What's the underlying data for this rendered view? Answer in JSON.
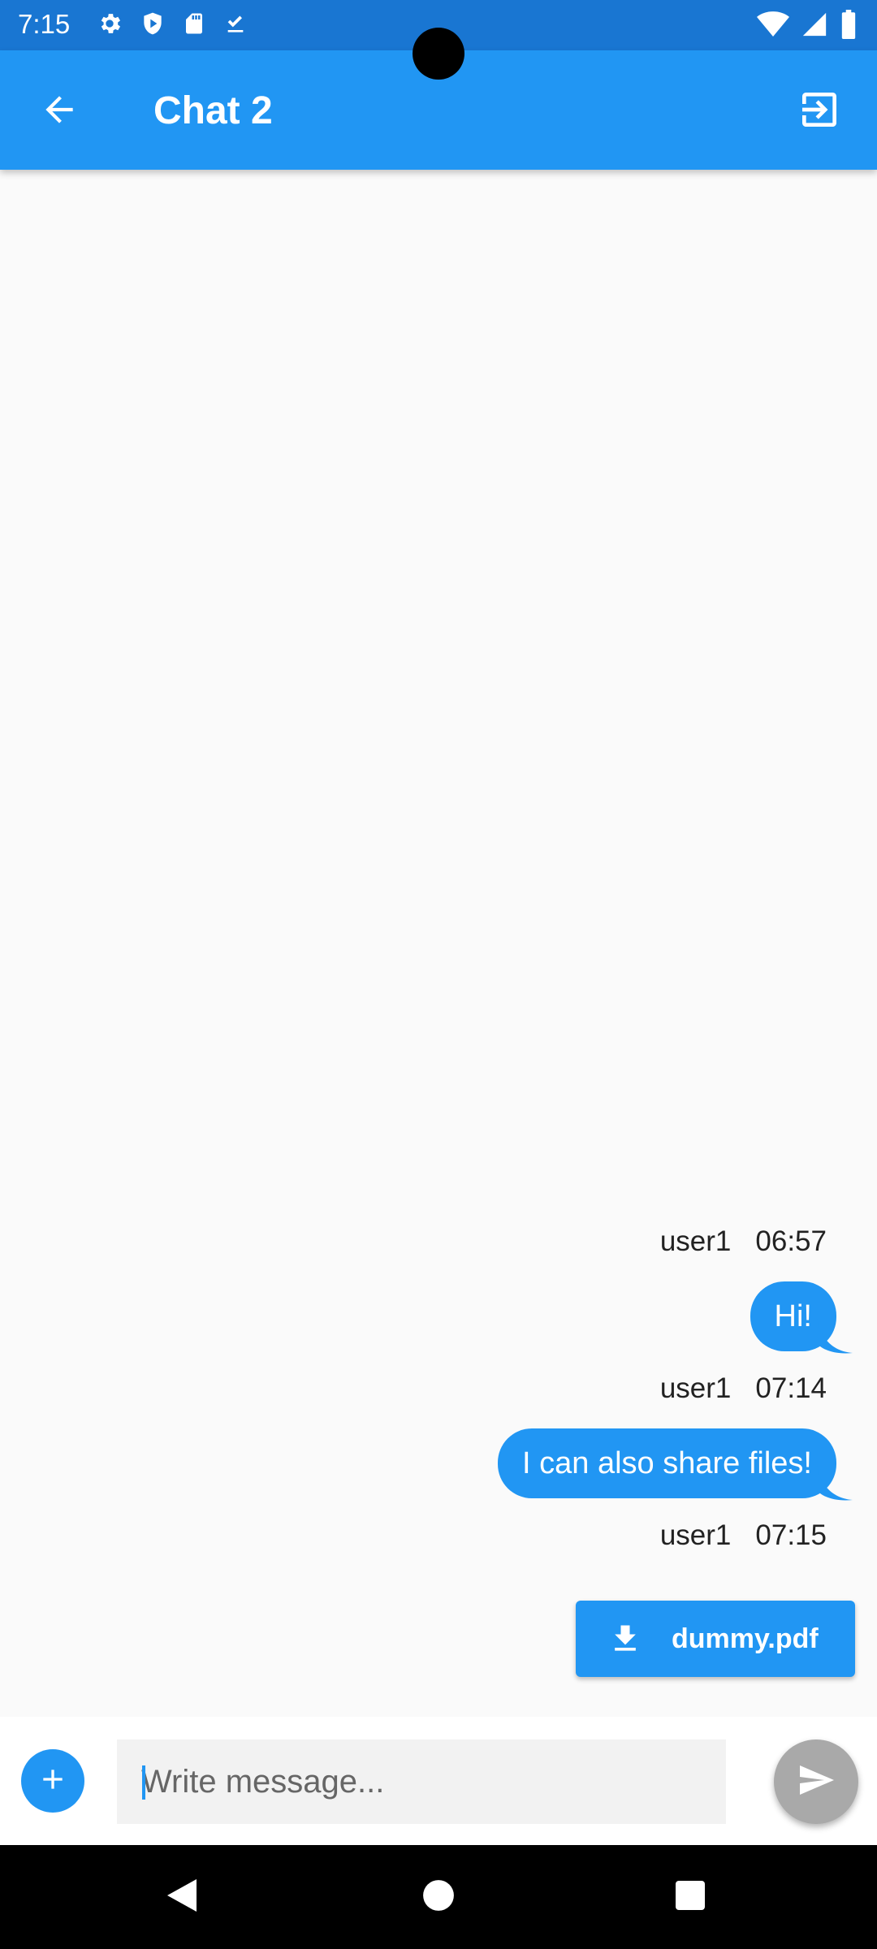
{
  "status_bar": {
    "time": "7:15",
    "left_icons": [
      "gear-icon",
      "shield-play-icon",
      "sd-card-icon",
      "download-done-icon"
    ],
    "right_icons": [
      "wifi-icon",
      "signal-icon",
      "battery-icon"
    ]
  },
  "app_bar": {
    "title": "Chat 2",
    "back_icon": "arrow-back-icon",
    "exit_icon": "exit-to-app-icon"
  },
  "messages": [
    {
      "user": "user1",
      "time": "06:57",
      "type": "text",
      "text": "Hi!"
    },
    {
      "user": "user1",
      "time": "07:14",
      "type": "text",
      "text": "I can also share files!"
    },
    {
      "user": "user1",
      "time": "07:15",
      "type": "file",
      "file_name": "dummy.pdf",
      "icon": "download-icon"
    }
  ],
  "input": {
    "placeholder": "Write message...",
    "value": "",
    "add_icon": "plus-icon",
    "send_icon": "send-icon"
  },
  "nav_bar": {
    "icons": [
      "back-triangle-icon",
      "home-circle-icon",
      "recents-square-icon"
    ]
  },
  "colors": {
    "status_bar": "#1976d2",
    "app_bar": "#2196f3",
    "bubble": "#2196f3",
    "send_disabled": "#a9a9a9",
    "background": "#fafafa"
  }
}
